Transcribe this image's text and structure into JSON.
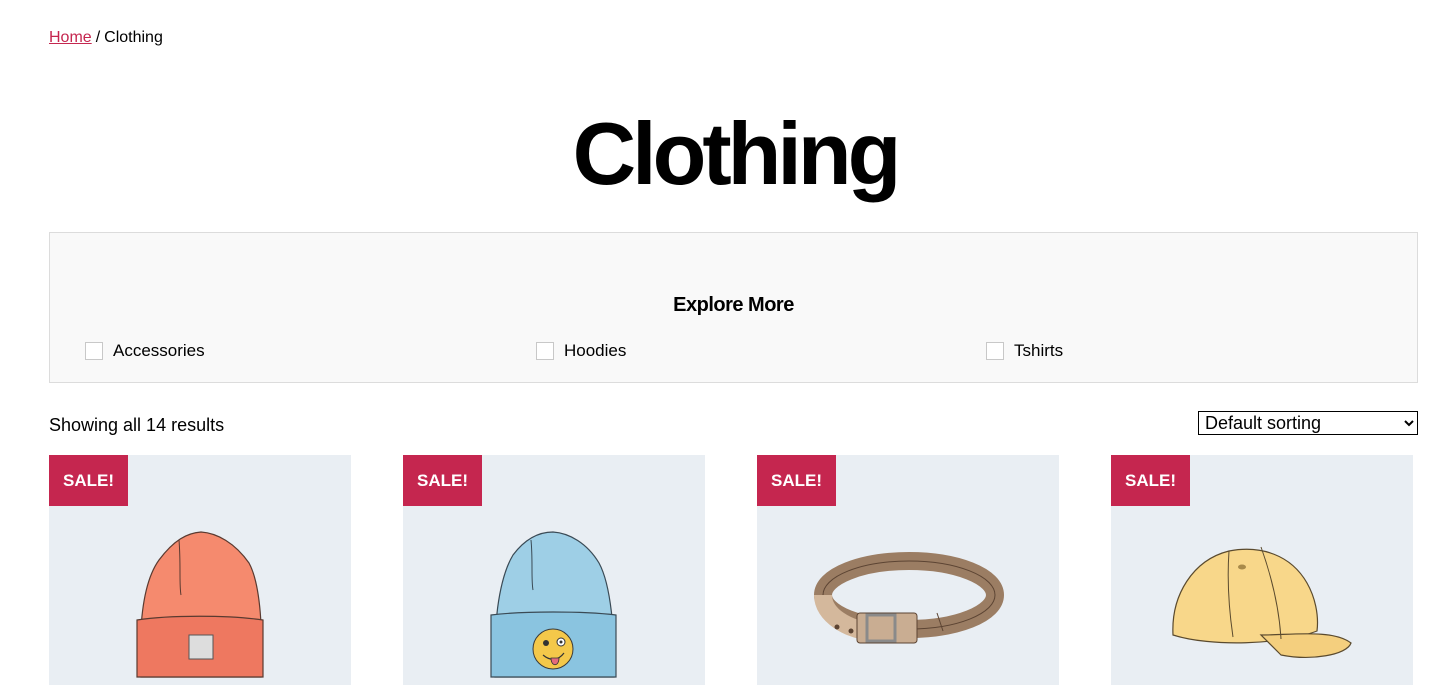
{
  "breadcrumb": {
    "home": "Home",
    "separator": "/",
    "current": "Clothing"
  },
  "page": {
    "title": "Clothing"
  },
  "explore": {
    "heading": "Explore More",
    "categories": [
      {
        "label": "Accessories"
      },
      {
        "label": "Hoodies"
      },
      {
        "label": "Tshirts"
      }
    ]
  },
  "results": {
    "text": "Showing all 14 results"
  },
  "sorting": {
    "selected": "Default sorting"
  },
  "products": [
    {
      "badge": "SALE!",
      "image": "orange-beanie"
    },
    {
      "badge": "SALE!",
      "image": "blue-beanie-with-emoji"
    },
    {
      "badge": "SALE!",
      "image": "leather-belt"
    },
    {
      "badge": "SALE!",
      "image": "yellow-cap"
    }
  ],
  "colors": {
    "accent": "#c5264f",
    "card_bg": "#e9eef3",
    "panel_bg": "#f9f9f9"
  }
}
